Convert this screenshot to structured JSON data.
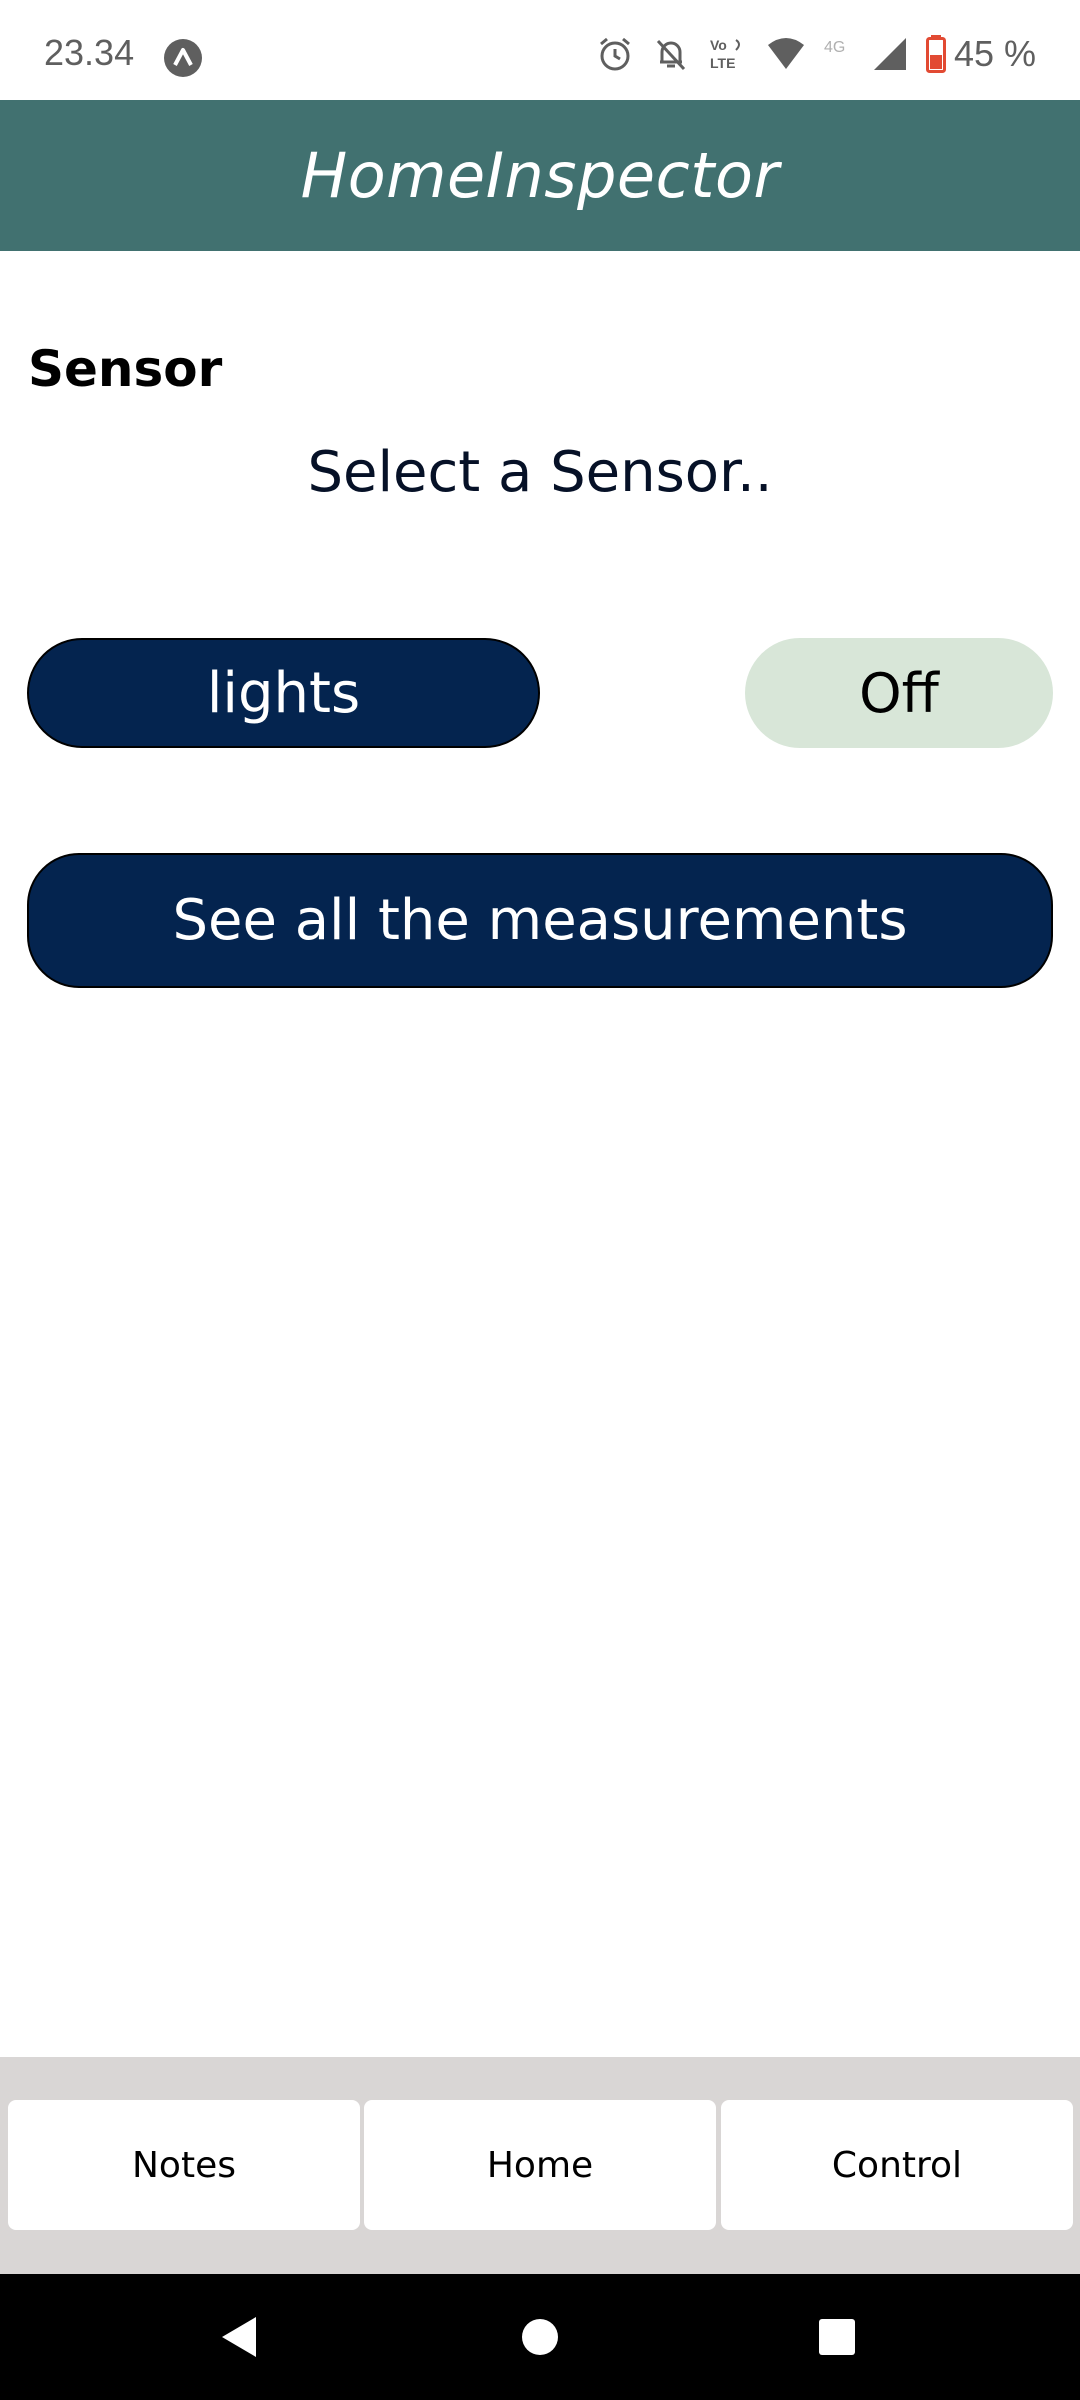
{
  "status_bar": {
    "time": "23.34",
    "battery": "45 %",
    "icons": [
      "app-notification-icon",
      "alarm-icon",
      "notifications-off-icon",
      "volte-icon",
      "wifi-icon",
      "4g-icon",
      "signal-icon",
      "battery-icon"
    ],
    "network_label": "4G",
    "volte_label_top": "Vo",
    "volte_label_bottom": "LTE"
  },
  "header": {
    "title": "HomeInspector",
    "background": "#417170"
  },
  "main": {
    "section_heading": "Sensor",
    "select_prompt": "Select a Sensor..",
    "sensor_button_label": "lights",
    "sensor_state_label": "Off",
    "measurements_button_label": "See all the measurements",
    "primary_color": "#04244f",
    "state_color": "#d8e6d8"
  },
  "tabs": [
    {
      "label": "Notes"
    },
    {
      "label": "Home"
    },
    {
      "label": "Control"
    }
  ],
  "nav_bar": {
    "icons": [
      "back-icon",
      "home-icon",
      "recents-icon"
    ]
  }
}
